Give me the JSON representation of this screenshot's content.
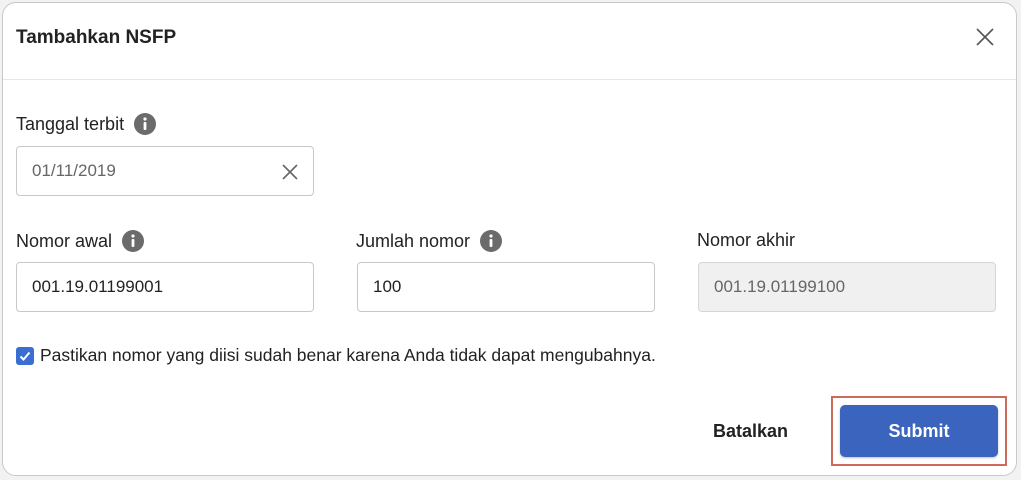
{
  "dialog": {
    "title": "Tambahkan NSFP"
  },
  "fields": {
    "tanggal_terbit": {
      "label": "Tanggal terbit",
      "value": "01/11/2019"
    },
    "nomor_awal": {
      "label": "Nomor awal",
      "value": "001.19.01199001"
    },
    "jumlah_nomor": {
      "label": "Jumlah nomor",
      "value": "100"
    },
    "nomor_akhir": {
      "label": "Nomor akhir",
      "value": "001.19.01199100"
    }
  },
  "confirm": {
    "checked": true,
    "text": "Pastikan nomor yang diisi sudah benar karena Anda tidak dapat mengubahnya."
  },
  "actions": {
    "cancel_label": "Batalkan",
    "submit_label": "Submit"
  },
  "colors": {
    "primary": "#3a64bd",
    "checkbox": "#3a6fd1",
    "highlight_outline": "#cc6a5c",
    "disabled_bg": "#f0f0f0"
  },
  "icons": {
    "close": "close-icon",
    "info": "info-icon",
    "clear": "clear-icon",
    "check": "check-icon"
  }
}
